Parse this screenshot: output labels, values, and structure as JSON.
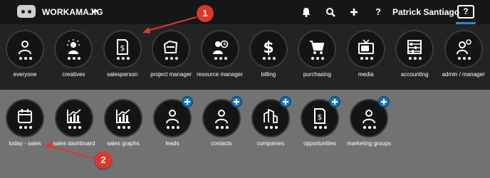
{
  "topbar": {
    "brand": "WORKAMAJIG",
    "user_name": "Patrick Santiago",
    "help_label": "?",
    "question_label": "?"
  },
  "row1": [
    {
      "label": "everyone",
      "icon": "person-icon"
    },
    {
      "label": "creatives",
      "icon": "creative-person-icon"
    },
    {
      "label": "salesperson",
      "icon": "dollar-document-icon"
    },
    {
      "label": "project manager",
      "icon": "project-folder-icon"
    },
    {
      "label": "resource manager",
      "icon": "person-clock-icon"
    },
    {
      "label": "billing",
      "icon": "dollar-icon"
    },
    {
      "label": "purchasing",
      "icon": "cart-icon"
    },
    {
      "label": "media",
      "icon": "tv-icon"
    },
    {
      "label": "accounting",
      "icon": "abacus-icon"
    },
    {
      "label": "admin / manager",
      "icon": "person-gear-icon"
    }
  ],
  "row2": [
    {
      "label": "today - sales",
      "icon": "calendar-icon",
      "has_plus": false
    },
    {
      "label": "sales dashboard",
      "icon": "bar-chart-icon",
      "has_plus": false
    },
    {
      "label": "sales graphs",
      "icon": "bar-chart-icon",
      "has_plus": false
    },
    {
      "label": "leads",
      "icon": "person-icon",
      "has_plus": true
    },
    {
      "label": "contacts",
      "icon": "person-icon",
      "has_plus": true
    },
    {
      "label": "companies",
      "icon": "buildings-icon",
      "has_plus": true
    },
    {
      "label": "opportunities",
      "icon": "dollar-document-icon",
      "has_plus": true
    },
    {
      "label": "marketing groups",
      "icon": "person-icon",
      "has_plus": true
    }
  ],
  "annotations": [
    {
      "number": "1"
    },
    {
      "number": "2"
    }
  ],
  "colors": {
    "topbar_bg": "#161616",
    "row1_bg": "#232323",
    "row2_bg": "#727272",
    "accent_blue": "#1f8dd6",
    "badge_red": "#e0372a"
  }
}
